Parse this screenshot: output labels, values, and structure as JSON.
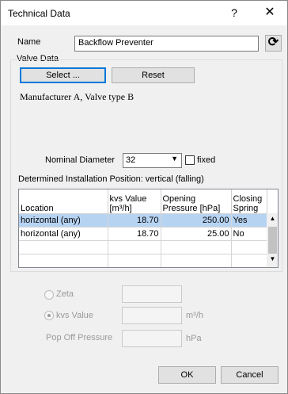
{
  "window": {
    "title": "Technical Data",
    "help_glyph": "?",
    "close_glyph": "✕"
  },
  "name": {
    "label": "Name",
    "value": "Backflow Preventer",
    "refresh_glyph": "⟳"
  },
  "valve_data": {
    "group_label": "Valve Data",
    "select_button": "Select ...",
    "reset_button": "Reset",
    "description": "Manufacturer A, Valve type B",
    "nominal_diameter_label": "Nominal Diameter",
    "nominal_diameter_value": "32",
    "fixed_label": "fixed",
    "installation_text": "Determined Installation Position: vertical (falling)",
    "table": {
      "headers": [
        "Location",
        "kvs Value [m³/h]",
        "Opening Pressure [hPa]",
        "Closing Spring"
      ],
      "rows": [
        [
          "horizontal (any)",
          "18.70",
          "250.00",
          "Yes"
        ],
        [
          "horizontal (any)",
          "18.70",
          "25.00",
          "No"
        ]
      ]
    }
  },
  "options": {
    "zeta_label": "Zeta",
    "kvs_label": "kvs Value",
    "kvs_unit": "m³/h",
    "popoff_label": "Pop Off Pressure",
    "popoff_unit": "hPa"
  },
  "footer": {
    "ok": "OK",
    "cancel": "Cancel"
  }
}
